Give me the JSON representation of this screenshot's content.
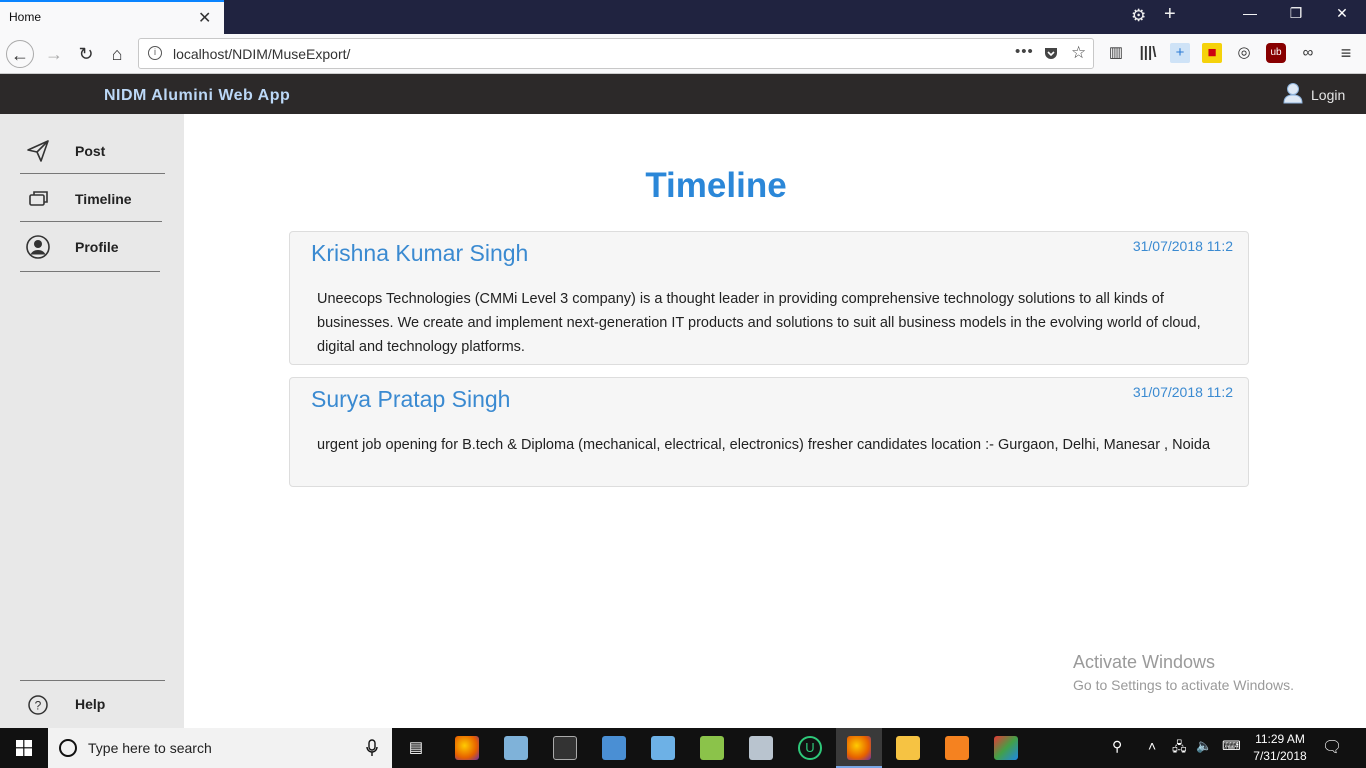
{
  "browser": {
    "tab_title": "Home",
    "url": "localhost/NDIM/MuseExport/",
    "url_dots": "•••"
  },
  "app": {
    "title": "NIDM Alumini Web App",
    "login_label": "Login"
  },
  "sidebar": {
    "items": [
      {
        "label": "Post",
        "icon": "paper-plane-icon"
      },
      {
        "label": "Timeline",
        "icon": "windows-stack-icon"
      },
      {
        "label": "Profile",
        "icon": "user-circle-icon"
      }
    ],
    "help_label": "Help"
  },
  "main": {
    "title": "Timeline",
    "posts": [
      {
        "author": "Krishna Kumar Singh",
        "date": "31/07/2018 11:2",
        "body": "Uneecops Technologies (CMMi Level 3 company) is a thought leader in providing comprehensive technology solutions to all kinds of businesses. We create and implement next-generation IT products and solutions to suit all business models in the evolving world of cloud, digital and technology platforms."
      },
      {
        "author": "Surya Pratap Singh",
        "date": "31/07/2018 11:2",
        "body": "urgent job opening for B.tech & Diploma (mechanical, electrical, electronics) fresher candidates location :- Gurgaon, Delhi, Manesar , Noida"
      }
    ]
  },
  "watermark": {
    "line1": "Activate Windows",
    "line2": "Go to Settings to activate Windows."
  },
  "taskbar": {
    "search_placeholder": "Type here to search",
    "time": "11:29 AM",
    "date": "7/31/2018"
  },
  "colors": {
    "accent": "#2b87d8",
    "app_header": "#2c2929",
    "sidebar": "#e8e8e8"
  }
}
